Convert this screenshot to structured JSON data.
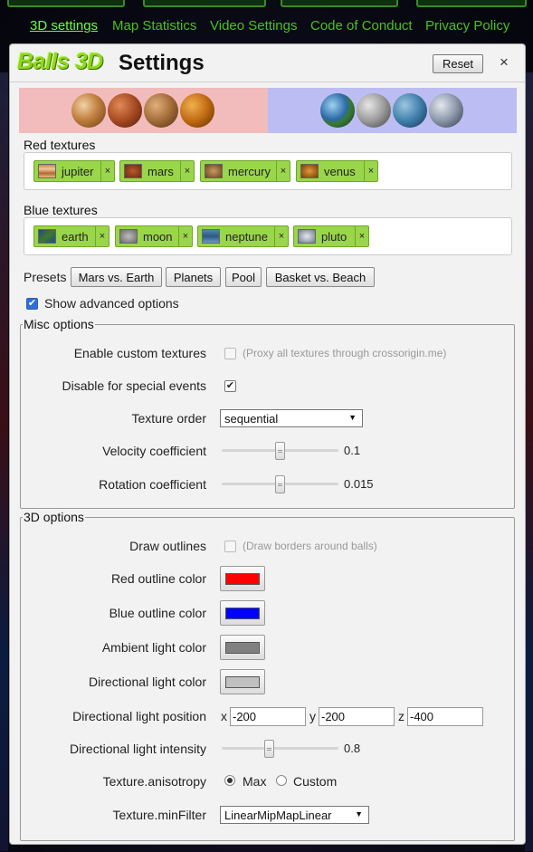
{
  "nav": {
    "items": [
      {
        "label": "3D settings",
        "active": true
      },
      {
        "label": "Map Statistics"
      },
      {
        "label": "Video Settings"
      },
      {
        "label": "Code of Conduct"
      },
      {
        "label": "Privacy Policy"
      }
    ]
  },
  "dialog": {
    "logo": "Balls 3D",
    "title": "Settings",
    "reset_label": "Reset",
    "close_glyph": "×"
  },
  "red_textures": {
    "label": "Red textures",
    "tags": [
      "jupiter",
      "mars",
      "mercury",
      "venus"
    ],
    "remove_glyph": "×"
  },
  "blue_textures": {
    "label": "Blue textures",
    "tags": [
      "earth",
      "moon",
      "neptune",
      "pluto"
    ],
    "remove_glyph": "×"
  },
  "presets": {
    "label": "Presets",
    "buttons": [
      "Mars vs. Earth",
      "Planets",
      "Pool",
      "Basket vs. Beach"
    ]
  },
  "advanced": {
    "label": "Show advanced options",
    "checked": true,
    "check_glyph": "✔"
  },
  "misc": {
    "legend": "Misc options",
    "custom_textures": {
      "label": "Enable custom textures",
      "hint": "(Proxy all textures through crossorigin.me)",
      "checked": false
    },
    "disable_events": {
      "label": "Disable for special events",
      "checked": true,
      "check_glyph": "✔"
    },
    "texture_order": {
      "label": "Texture order",
      "value": "sequential"
    },
    "velocity": {
      "label": "Velocity coefficient",
      "value": "0.1"
    },
    "rotation": {
      "label": "Rotation coefficient",
      "value": "0.015"
    }
  },
  "options3d": {
    "legend": "3D options",
    "draw_outlines": {
      "label": "Draw outlines",
      "hint": "(Draw borders around balls)",
      "checked": false
    },
    "red_outline": {
      "label": "Red outline color",
      "color": "#ff0000"
    },
    "blue_outline": {
      "label": "Blue outline color",
      "color": "#0000ff"
    },
    "ambient": {
      "label": "Ambient light color",
      "color": "#808080"
    },
    "directional": {
      "label": "Directional light color",
      "color": "#c0c0c0"
    },
    "light_position": {
      "label": "Directional light position",
      "x_label": "x",
      "x": "-200",
      "y_label": "y",
      "y": "-200",
      "z_label": "z",
      "z": "-400"
    },
    "intensity": {
      "label": "Directional light intensity",
      "value": "0.8"
    },
    "anisotropy": {
      "label": "Texture.anisotropy",
      "options": [
        "Max",
        "Custom"
      ],
      "selected": "Max"
    },
    "min_filter": {
      "label": "Texture.minFilter",
      "value": "LinearMipMapLinear"
    }
  },
  "colors": {
    "nav_green": "#48c21d",
    "tag_green": "#9ad64a",
    "red_banner": "#f2bcbc",
    "blue_banner": "#bcbdf2"
  }
}
